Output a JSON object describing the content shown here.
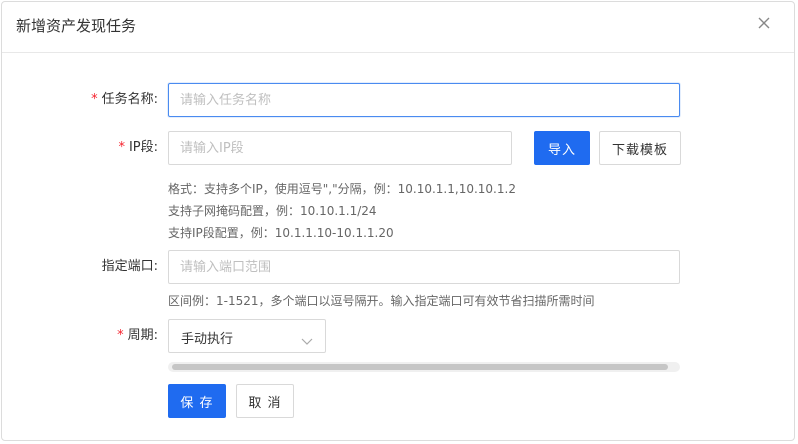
{
  "dialog": {
    "title": "新增资产发现任务",
    "close_icon": "close-icon"
  },
  "form": {
    "task_name": {
      "required": "*",
      "label": "任务名称:",
      "value": "",
      "placeholder": "请输入任务名称"
    },
    "ip_range": {
      "required": "*",
      "label": "IP段:",
      "value": "",
      "placeholder": "请输入IP段",
      "import_label": "导入",
      "template_label": "下载模板",
      "hints": [
        "格式：支持多个IP，使用逗号\",\"分隔，例：10.10.1.1,10.10.1.2",
        "支持子网掩码配置，例：10.10.1.1/24",
        "支持IP段配置，例：10.1.1.10-10.1.1.20"
      ]
    },
    "port": {
      "label": "指定端口:",
      "value": "",
      "placeholder": "请输入端口范围",
      "hint": "区间例：1-1521，多个端口以逗号隔开。输入指定端口可有效节省扫描所需时间"
    },
    "period": {
      "required": "*",
      "label": "周期:",
      "selected": "手动执行",
      "dropdown_icon": "chevron-down-icon"
    }
  },
  "footer": {
    "save_label": "保 存",
    "cancel_label": "取 消"
  },
  "colors": {
    "primary": "#1f6bf0",
    "required": "#f5222d",
    "focus_border": "#4a8bf0"
  }
}
